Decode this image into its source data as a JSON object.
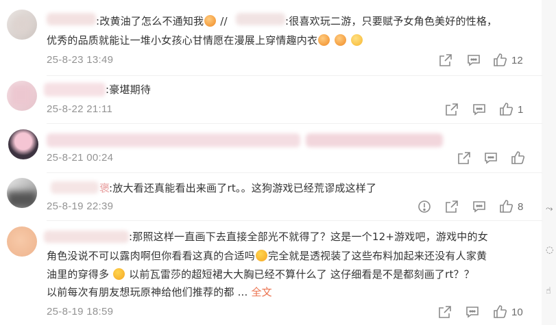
{
  "comments": [
    {
      "id": 1,
      "segments": [
        ":改黄油了怎么不通知我",
        " //",
        ":很喜欢玩二游，只要赋予女角色美好的性格，"
      ],
      "line2": "优秀的品质就能让一堆小女孩心甘情愿在漫展上穿情趣内衣",
      "time": "25-8-23 13:49",
      "likes": "12"
    },
    {
      "id": 2,
      "text": ":豪堪期待",
      "time": "25-8-22 21:11",
      "likes": "1"
    },
    {
      "id": 3,
      "time": "25-8-21 00:24",
      "likes": ""
    },
    {
      "id": 4,
      "name_tail": "褒",
      "text": ":放大看还真能看出来画了rt。。这狗游戏已经荒谬成这样了",
      "time": "25-8-19 22:39",
      "likes": "8"
    },
    {
      "id": 5,
      "line1": ":那照这样一直画下去直接全部光不就得了？这是一个12+游戏吧，游戏中的女",
      "line2a": "角色没说不可以露肉啊但你看看这真的合适吗",
      "line2b": "完全就是透视装了这些布料加起来还没有人家黄",
      "line3a": "油里的穿得多",
      "line3b": " 以前瓦雷莎的超短裙大大胸已经不算什么了 这仔细看是不是都刻画了rt？？",
      "line4": "以前每次有朋友想玩原神给他们推荐的都 ...",
      "more": "全文",
      "time": "25-8-19 18:59",
      "likes": "10"
    }
  ],
  "icons": [
    "share-icon",
    "comment-icon",
    "like-icon",
    "report-icon"
  ],
  "colors": {
    "link": "#eb7350",
    "meta": "#939393",
    "icon": "#8a8a8a"
  }
}
